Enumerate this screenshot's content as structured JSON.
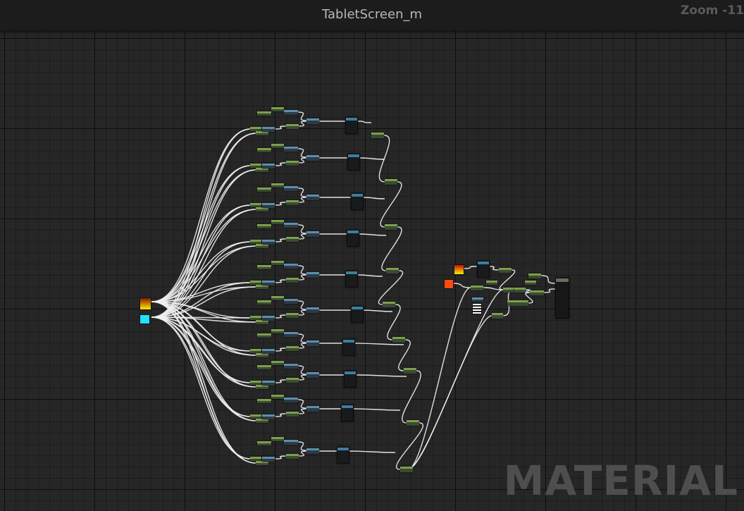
{
  "graph": {
    "title": "TabletScreen_m",
    "zoom_label": "Zoom -11",
    "watermark": "MATERIAL"
  },
  "colors": {
    "background": "#262626",
    "wire": "#f0f0f0",
    "constant_node_header": "#7d9e4a",
    "math_node_header": "#5b8fae",
    "texture_sampler_header": "#3b7ea3",
    "swatch_gradient_top": "#8a1a00",
    "swatch_gradient_bottom": "#ffee00",
    "swatch_cyan": "#22e0ff",
    "swatch_orange": "#ff4a10"
  }
}
